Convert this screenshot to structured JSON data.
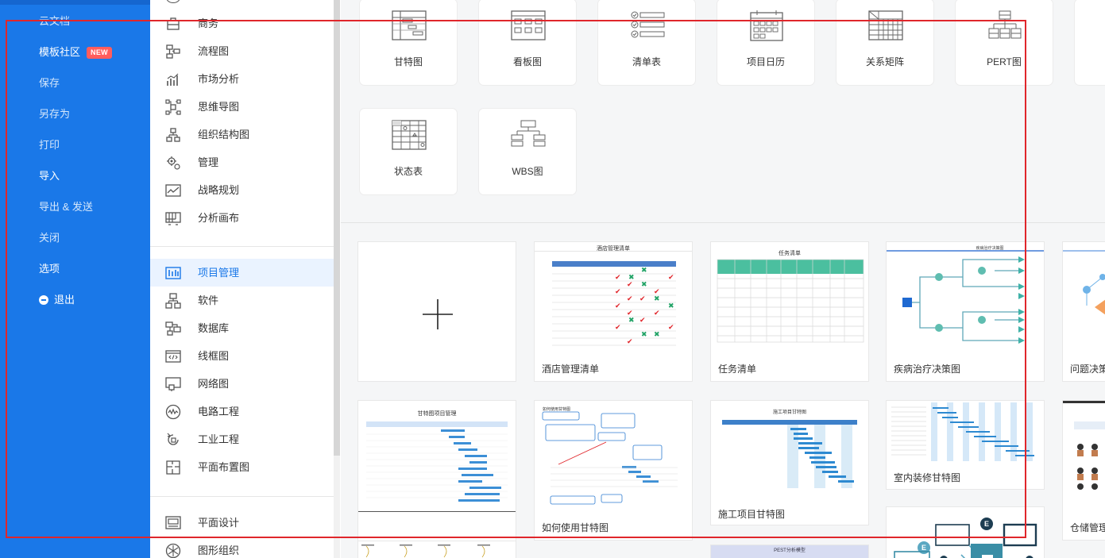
{
  "left_nav": {
    "items": [
      {
        "label": "云文档"
      },
      {
        "label": "模板社区",
        "badge": "NEW"
      },
      {
        "label": "保存"
      },
      {
        "label": "另存为"
      },
      {
        "label": "打印"
      },
      {
        "label": "导入"
      },
      {
        "label": "导出 & 发送"
      },
      {
        "label": "关闭"
      },
      {
        "label": "选项"
      },
      {
        "label": "退出"
      }
    ]
  },
  "categories": {
    "group1": [
      {
        "label": "商务",
        "icon": "briefcase-icon"
      },
      {
        "label": "流程图",
        "icon": "flowchart-icon"
      },
      {
        "label": "市场分析",
        "icon": "bar-chart-icon"
      },
      {
        "label": "思维导图",
        "icon": "mindmap-icon"
      },
      {
        "label": "组织结构图",
        "icon": "org-chart-icon"
      },
      {
        "label": "管理",
        "icon": "gear-people-icon"
      },
      {
        "label": "战略规划",
        "icon": "line-chart-icon"
      },
      {
        "label": "分析画布",
        "icon": "canvas-grid-icon"
      }
    ],
    "group2": [
      {
        "label": "项目管理",
        "icon": "project-icon",
        "active": true
      },
      {
        "label": "软件",
        "icon": "software-icon"
      },
      {
        "label": "数据库",
        "icon": "database-icon"
      },
      {
        "label": "线框图",
        "icon": "wireframe-icon"
      },
      {
        "label": "网络图",
        "icon": "network-icon"
      },
      {
        "label": "电路工程",
        "icon": "circuit-icon"
      },
      {
        "label": "工业工程",
        "icon": "industry-icon"
      },
      {
        "label": "平面布置图",
        "icon": "floorplan-icon"
      }
    ],
    "group3": [
      {
        "label": "平面设计",
        "icon": "image-icon"
      },
      {
        "label": "图形组织",
        "icon": "graphic-org-icon"
      }
    ]
  },
  "template_types": [
    {
      "label": "甘特图",
      "icon": "gantt-icon"
    },
    {
      "label": "看板图",
      "icon": "kanban-icon"
    },
    {
      "label": "清单表",
      "icon": "checklist-icon"
    },
    {
      "label": "项目日历",
      "icon": "calendar-icon"
    },
    {
      "label": "关系矩阵",
      "icon": "matrix-icon"
    },
    {
      "label": "PERT图",
      "icon": "pert-icon"
    },
    {
      "label": "状态表",
      "icon": "status-table-icon"
    },
    {
      "label": "WBS图",
      "icon": "wbs-icon"
    }
  ],
  "examples": {
    "new_blank": "+",
    "cards": [
      {
        "title": "酒店管理清单",
        "thumb_title": "酒店管理清单"
      },
      {
        "title": "任务清单",
        "thumb_title": "任务清单"
      },
      {
        "title": "疾病治疗决策图",
        "thumb_title": "疾病治疗决策图"
      },
      {
        "title": "问题决策"
      },
      {
        "title": "",
        "thumb_title": "甘特图项目管理"
      },
      {
        "title": "如何使用甘特图",
        "thumb_title": "如何使用甘特图"
      },
      {
        "title": "施工项目甘特图",
        "thumb_title": "施工项目甘特图"
      },
      {
        "title": "室内装修甘特图"
      },
      {
        "title": "仓储管理"
      },
      {
        "title": "",
        "thumb_title": "PEST分析模型"
      }
    ]
  },
  "colors": {
    "nav_blue": "#1a78e8",
    "badge_red": "#ff5d5d",
    "selection_red": "#e0262b",
    "check_red": "#e0262b",
    "check_green": "#21a366",
    "teal": "#2e9e8f"
  }
}
